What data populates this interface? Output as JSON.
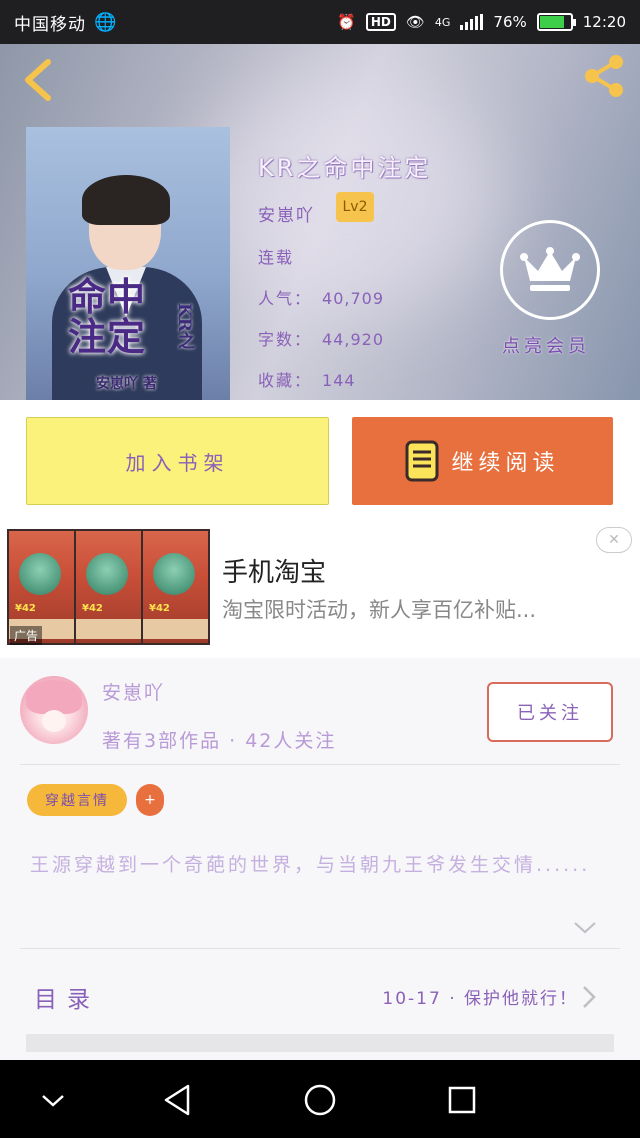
{
  "status_bar": {
    "carrier": "中国移动",
    "hd": "HD",
    "network": "4G",
    "battery_level": 0.76,
    "battery_text": "76%",
    "time": "12:20"
  },
  "header": {
    "back_icon": "chevron-left-icon",
    "share_icon": "share-icon"
  },
  "book": {
    "cover_title": "命中注定",
    "cover_kr": "KR之",
    "cover_author": "安崽吖 著",
    "title": "KR之命中注定",
    "author": "安崽吖",
    "level": "Lv2",
    "status": "连载",
    "popularity_label": "人气：",
    "popularity": "40,709",
    "word_count_label": "字数：",
    "word_count": "44,920",
    "favorites_label": "收藏：",
    "favorites": "144"
  },
  "vip": {
    "icon": "crown-icon",
    "label": "点亮会员"
  },
  "actions": {
    "add_to_shelf": "加入书架",
    "continue_reading": "继续阅读"
  },
  "ad": {
    "prices": [
      "¥42",
      "¥42",
      "¥42"
    ],
    "tag": "广告",
    "title": "手机淘宝",
    "description": "淘宝限时活动，新人享百亿补贴...",
    "close_icon": "close-icon"
  },
  "author_card": {
    "name": "安崽吖",
    "stats": "著有3部作品 · 42人关注",
    "follow_label": "已关注",
    "genre_tag": "穿越言情",
    "add_tag": "+",
    "synopsis": "王源穿越到一个奇葩的世界，与当朝九王爷发生交情......",
    "toc_label": "目录",
    "latest_chapter": "10-17 · 保护他就行！"
  },
  "nav_bar": {
    "icons": [
      "chevron-down-icon",
      "back-triangle-icon",
      "home-circle-icon",
      "recents-square-icon"
    ]
  },
  "colors": {
    "accent_orange": "#e8703e",
    "shelf_yellow": "#fbf27b",
    "purple_text": "#8a61b8",
    "vip_gold": "#f6c34c"
  }
}
